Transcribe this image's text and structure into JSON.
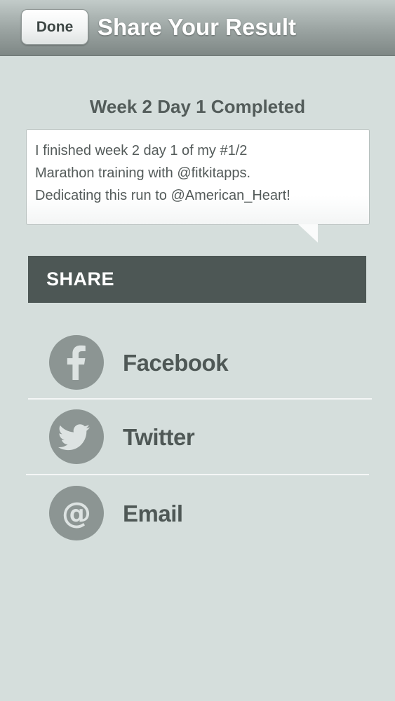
{
  "navbar": {
    "done_label": "Done",
    "title": "Share Your Result"
  },
  "status": {
    "title": "Week 2 Day 1 Completed"
  },
  "message": {
    "lines": [
      "I finished week 2 day 1 of my #1/2",
      "Marathon training with @fitkitapps.",
      "Dedicating this run to @American_Heart!"
    ]
  },
  "share": {
    "header": "SHARE",
    "options": [
      {
        "label": "Facebook",
        "icon": "facebook-icon"
      },
      {
        "label": "Twitter",
        "icon": "twitter-icon"
      },
      {
        "label": "Email",
        "icon": "at-sign-icon"
      }
    ]
  },
  "colors": {
    "background": "#d5dedc",
    "header_bar": "#4d5755",
    "icon_circle": "#8c9593",
    "label_text": "#4f5856"
  }
}
